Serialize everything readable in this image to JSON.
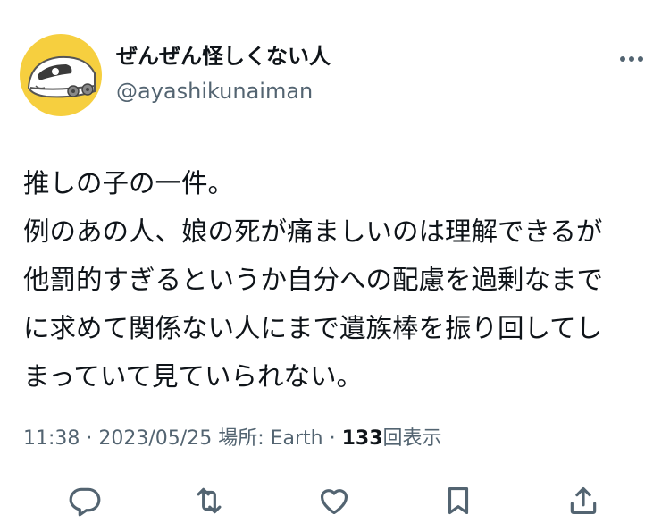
{
  "user": {
    "display_name": "ぜんぜん怪しくない人",
    "handle": "@ayashikunaiman",
    "avatar_icon": "shinkansen-cartoon-avatar"
  },
  "tweet": {
    "text": "推しの子の一件。\n例のあの人、娘の死が痛ましいのは理解できるが\n他罰的すぎるというか自分への配慮を過剰なまで\nに求めて関係ない人にまで遺族棒を振り回してし\nまっていて見ていられない。"
  },
  "meta": {
    "time": "11:38",
    "separator1": " · ",
    "date": "2023/05/25",
    "location": " 場所: Earth",
    "separator2": " · ",
    "views_count": "133",
    "views_label": "回表示"
  },
  "actions": [
    {
      "name": "reply",
      "icon": "reply-icon"
    },
    {
      "name": "retweet",
      "icon": "retweet-icon"
    },
    {
      "name": "like",
      "icon": "heart-icon"
    },
    {
      "name": "bookmark",
      "icon": "bookmark-icon"
    },
    {
      "name": "share",
      "icon": "share-icon"
    }
  ],
  "colors": {
    "text": "#0f1419",
    "secondary": "#536471",
    "avatar_bg": "#f6cf3f",
    "background": "#ffffff"
  }
}
